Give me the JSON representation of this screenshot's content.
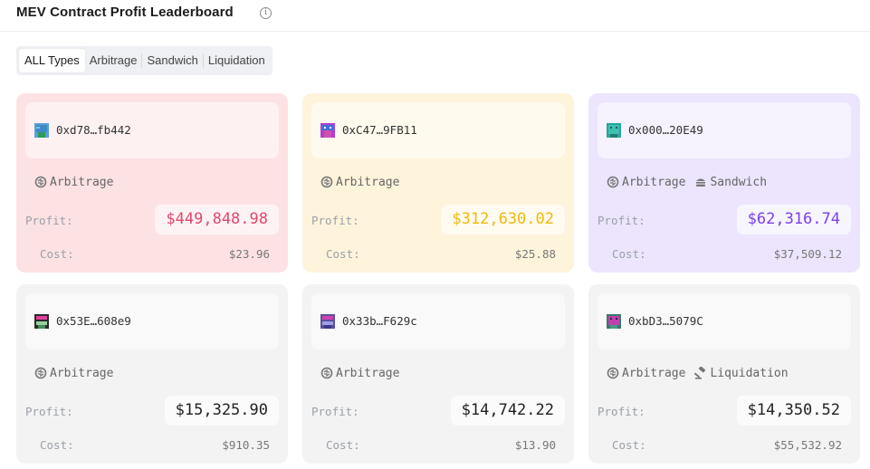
{
  "header": {
    "title": "MEV Contract Profit Leaderboard",
    "info_icon": "info-icon"
  },
  "tabs": [
    {
      "label": "ALL Types",
      "active": true
    },
    {
      "label": "Arbitrage",
      "active": false
    },
    {
      "label": "Sandwich",
      "active": false
    },
    {
      "label": "Liquidation",
      "active": false
    }
  ],
  "labels": {
    "profit": "Profit:",
    "cost": "Cost:"
  },
  "colors": {
    "pink_profit": "#e2476e",
    "yellow_profit": "#f1b80a",
    "purple_profit": "#7a3ff0",
    "gray_profit": "#222222"
  },
  "cards": [
    {
      "address": "0xd78…fb442",
      "types": [
        "Arbitrage"
      ],
      "profit": "$449,848.98",
      "cost": "$23.96",
      "theme": "pink"
    },
    {
      "address": "0xC47…9FB11",
      "types": [
        "Arbitrage"
      ],
      "profit": "$312,630.02",
      "cost": "$25.88",
      "theme": "yellow"
    },
    {
      "address": "0x000…20E49",
      "types": [
        "Arbitrage",
        "Sandwich"
      ],
      "profit": "$62,316.74",
      "cost": "$37,509.12",
      "theme": "purple"
    },
    {
      "address": "0x53E…608e9",
      "types": [
        "Arbitrage"
      ],
      "profit": "$15,325.90",
      "cost": "$910.35",
      "theme": "gray"
    },
    {
      "address": "0x33b…F629c",
      "types": [
        "Arbitrage"
      ],
      "profit": "$14,742.22",
      "cost": "$13.90",
      "theme": "gray"
    },
    {
      "address": "0xbD3…5079C",
      "types": [
        "Arbitrage",
        "Liquidation"
      ],
      "profit": "$14,350.52",
      "cost": "$55,532.92",
      "theme": "gray"
    }
  ]
}
